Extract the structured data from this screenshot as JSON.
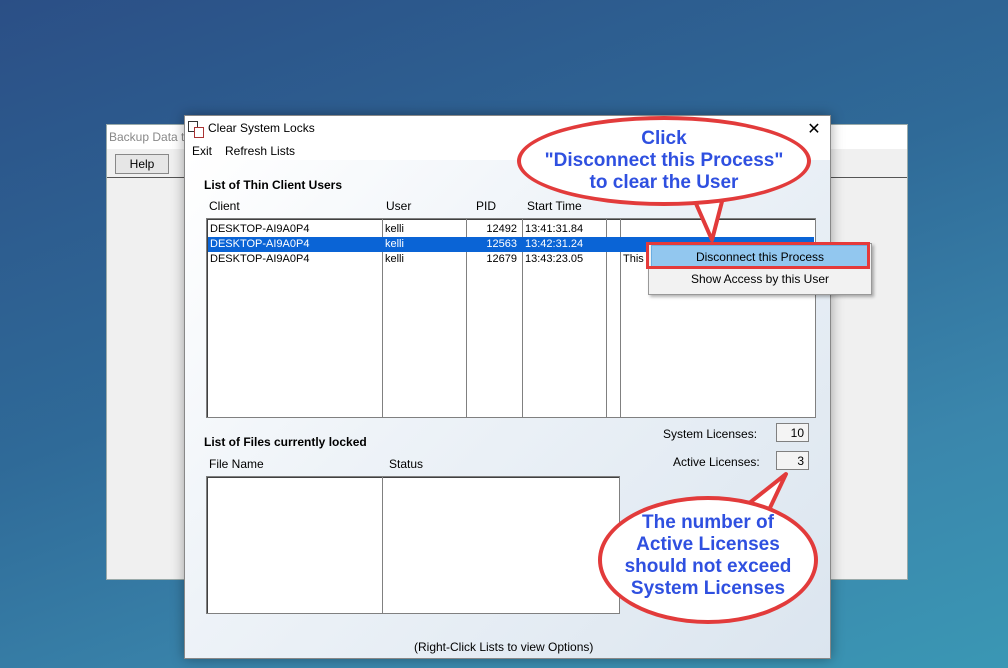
{
  "background_window": {
    "title": "Backup Data t",
    "help_label": "Help"
  },
  "dialog": {
    "title": "Clear System Locks",
    "menu": {
      "exit": "Exit",
      "refresh": "Refresh Lists"
    },
    "thin_clients": {
      "heading": "List of Thin Client Users",
      "columns": [
        "Client",
        "User",
        "PID",
        "Start Time"
      ],
      "rows": [
        {
          "client": "DESKTOP-AI9A0P4",
          "user": "kelli",
          "pid": "12492",
          "start": "13:41:31.84",
          "extra": ""
        },
        {
          "client": "DESKTOP-AI9A0P4",
          "user": "kelli",
          "pid": "12563",
          "start": "13:42:31.24",
          "extra": ""
        },
        {
          "client": "DESKTOP-AI9A0P4",
          "user": "kelli",
          "pid": "12679",
          "start": "13:43:23.05",
          "extra": "This"
        }
      ],
      "selected_index": 1
    },
    "files_locked": {
      "heading": "List of Files currently locked",
      "columns": [
        "File Name",
        "Status"
      ]
    },
    "licenses": {
      "system_label": "System Licenses:",
      "system_value": "10",
      "active_label": "Active Licenses:",
      "active_value": "3"
    },
    "footer": "(Right-Click Lists to view Options)"
  },
  "context_menu": {
    "items": [
      "Disconnect this Process",
      "Show Access by this User"
    ]
  },
  "callouts": {
    "top": [
      "Click",
      "\"Disconnect this Process\"",
      "to clear the User"
    ],
    "bottom": [
      "The number of",
      "Active Licenses",
      "should not exceed",
      "System Licenses"
    ]
  },
  "colors": {
    "selection": "#0a64d6",
    "callout_border": "#e23b3b",
    "callout_text": "#2f50e0"
  }
}
